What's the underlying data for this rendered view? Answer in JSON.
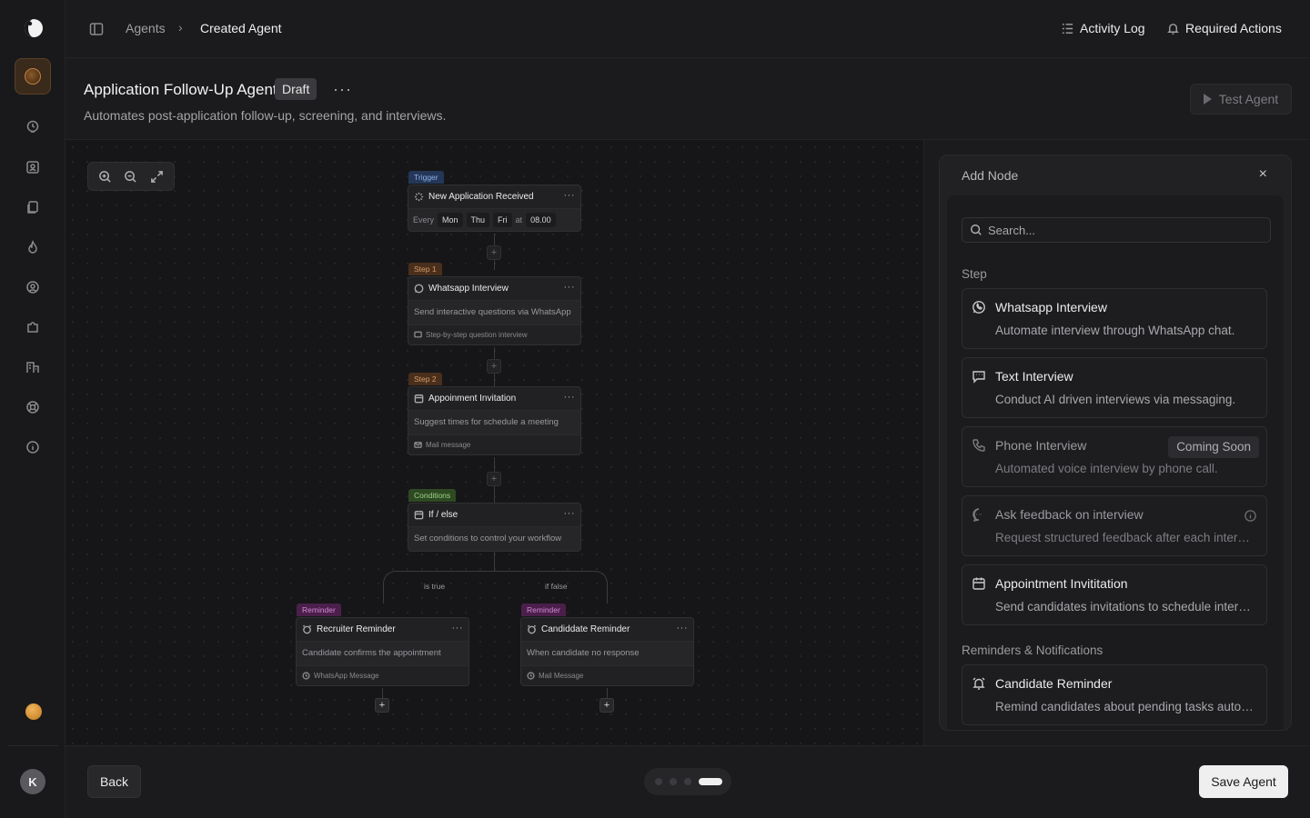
{
  "breadcrumb": {
    "parent": "Agents",
    "separator": "›",
    "current": "Created Agent"
  },
  "topbar": {
    "activity_log": "Activity Log",
    "required_actions": "Required Actions"
  },
  "agent": {
    "title": "Application Follow-Up Agent",
    "status": "Draft",
    "more": "···",
    "description": "Automates post-application follow-up, screening, and interviews.",
    "test_label": "Test Agent"
  },
  "user": {
    "initial": "K"
  },
  "workflow": {
    "trigger": {
      "tag": "Trigger",
      "title": "New Application Received",
      "every": "Every",
      "days": [
        "Mon",
        "Thu",
        "Fri"
      ],
      "at": "at",
      "time": "08.00"
    },
    "step1": {
      "tag": "Step 1",
      "title": "Whatsapp Interview",
      "desc": "Send interactive questions via WhatsApp",
      "foot": "Step-by-step question interview"
    },
    "step2": {
      "tag": "Step 2",
      "title": "Appoinment Invitation",
      "desc": "Suggest times for schedule a meeting",
      "foot": "Mail message"
    },
    "condition": {
      "tag": "Conditions",
      "title": "If / else",
      "desc": "Set conditions to control your workflow",
      "true_label": "is true",
      "false_label": "if false"
    },
    "reminder_left": {
      "tag": "Reminder",
      "title": "Recruiter Reminder",
      "desc": "Candidate confirms the appointment",
      "foot": "WhatsApp Message"
    },
    "reminder_right": {
      "tag": "Reminder",
      "title": "Candiddate Reminder",
      "desc": "When candidate no response",
      "foot": "Mail Message"
    },
    "more": "···",
    "plus": "+"
  },
  "panel": {
    "title": "Add Node",
    "close": "×",
    "search_placeholder": "Search...",
    "section_step": "Step",
    "section_reminders": "Reminders & Notifications",
    "items": [
      {
        "title": "Whatsapp Interview",
        "desc": "Automate interview through WhatsApp chat.",
        "icon": "whatsapp-icon"
      },
      {
        "title": "Text Interview",
        "desc": "Conduct AI driven interviews via messaging.",
        "icon": "message-icon"
      },
      {
        "title": "Phone Interview",
        "desc": "Automated voice interview by phone call.",
        "badge": "Coming Soon",
        "icon": "phone-icon"
      },
      {
        "title": "Ask feedback on interview",
        "desc": "Request structured feedback after each interview.",
        "icon": "chat-bubble-icon"
      },
      {
        "title": "Appointment Invititation",
        "desc": "Send candidates invitations to schedule interviews.",
        "icon": "calendar-icon"
      },
      {
        "title": "Candidate Reminder",
        "desc": "Remind candidates about pending tasks automatically.",
        "icon": "alarm-icon"
      }
    ]
  },
  "footer": {
    "back": "Back",
    "save": "Save Agent",
    "pager": {
      "pages": 4,
      "current": 4
    }
  }
}
